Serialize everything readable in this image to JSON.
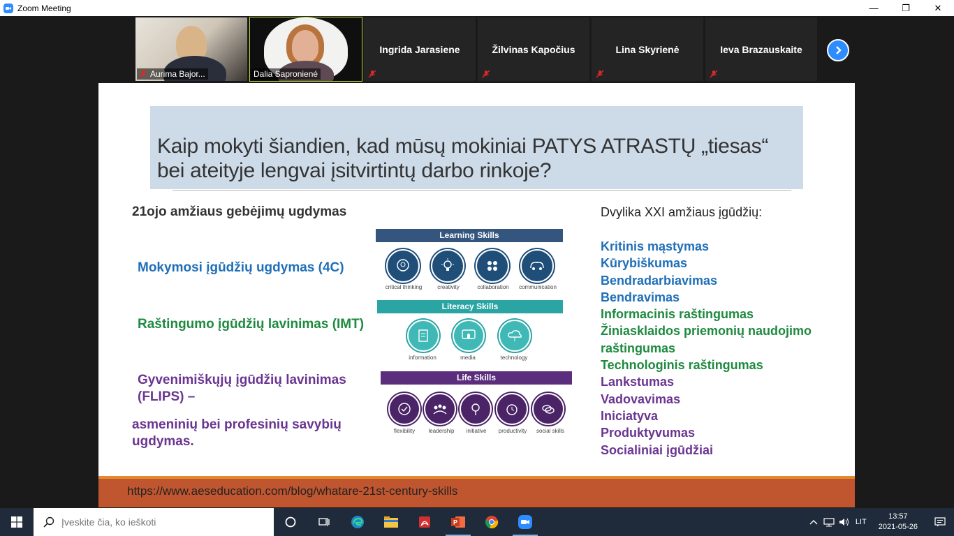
{
  "window": {
    "title": "Zoom Meeting",
    "minimize": "—",
    "maximize": "❐",
    "close": "✕"
  },
  "gallery": {
    "participants": [
      {
        "name": "Aurima Bajor...",
        "video": true
      },
      {
        "name": "Dalia Saproniené",
        "video": true,
        "active": true
      },
      {
        "name": "Ingrida Jarasiene",
        "video": false
      },
      {
        "name": "Žilvinas Kapočius",
        "video": false
      },
      {
        "name": "Lina Skyrienė",
        "video": false
      },
      {
        "name": "Ieva Brazauskaite",
        "video": false
      }
    ],
    "next_icon": "chevron-right-icon"
  },
  "slide": {
    "title_line1": "Kaip mokyti šiandien, kad mūsų mokiniai PATYS ATRASTŲ „tiesas“",
    "title_line2": "bei ateityje lengvai įsitvirtintų darbo rinkoje?",
    "left_heading": "21ojo amžiaus gebėjimų ugdymas",
    "left_items": {
      "learning": "Mokymosi įgūdžių ugdymas (4C)",
      "literacy": "Raštingumo įgūdžių lavinimas (IMT)",
      "life_line1": "Gyvenimiškųjų įgūdžių lavinimas",
      "life_line2": "(FLIPS) –",
      "personal_line1": "asmeninių bei profesinių savybių",
      "personal_line2": "ugdymas."
    },
    "infographic": {
      "learning_title": "Learning Skills",
      "learning": [
        "critical thinking",
        "creativity",
        "collaboration",
        "communication"
      ],
      "literacy_title": "Literacy Skills",
      "literacy": [
        "information",
        "media",
        "technology"
      ],
      "life_title": "Life Skills",
      "life": [
        "flexibility",
        "leadership",
        "initiative",
        "productivity",
        "social skills"
      ],
      "colors": {
        "learning": "#1f4e79",
        "literacy": "#2aa5a3",
        "life": "#4a2466"
      }
    },
    "right_heading": "Dvylika XXI amžiaus įgūdžių:",
    "right_items": [
      {
        "text": "Kritinis mąstymas",
        "color": "blue"
      },
      {
        "text": "Kūrybiškumas",
        "color": "blue"
      },
      {
        "text": "Bendradarbiavimas",
        "color": "blue"
      },
      {
        "text": "Bendravimas",
        "color": "blue"
      },
      {
        "text": "Informacinis raštingumas",
        "color": "green"
      },
      {
        "text": "Žiniasklaidos priemonių naudojimo",
        "color": "green"
      },
      {
        "text": "raštingumas",
        "color": "green"
      },
      {
        "text": "Technologinis raštingumas",
        "color": "green"
      },
      {
        "text": "Lankstumas",
        "color": "purple"
      },
      {
        "text": "Vadovavimas",
        "color": "purple"
      },
      {
        "text": "Iniciatyva",
        "color": "purple"
      },
      {
        "text": "Produktyvumas",
        "color": "purple"
      },
      {
        "text": "Socialiniai įgūdžiai",
        "color": "purple"
      }
    ],
    "footer_link": "https://www.aeseducation.com/blog/whatare-21st-century-skills"
  },
  "taskbar": {
    "search_placeholder": "Įveskite čia, ko ieškoti",
    "language": "LIT",
    "time": "13:57",
    "date": "2021-05-26"
  }
}
